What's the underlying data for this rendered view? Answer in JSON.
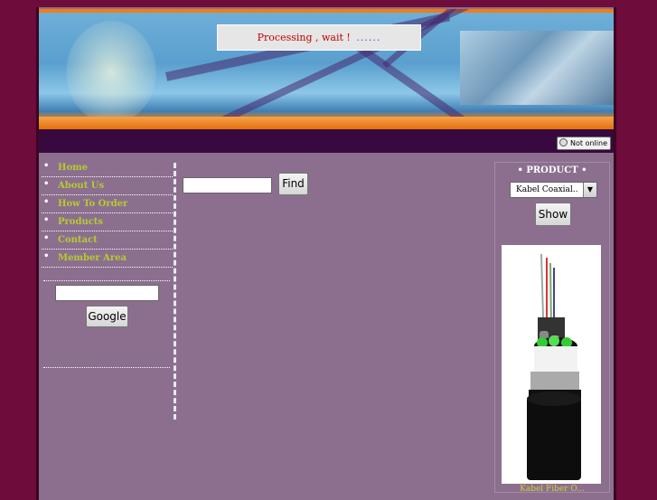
{
  "header": {
    "processing_text": "Processing , wait !",
    "processing_dots": "......"
  },
  "status": {
    "chat_badge": "Not online"
  },
  "nav": {
    "items": [
      {
        "label": "Home"
      },
      {
        "label": "About Us"
      },
      {
        "label": "How To Order"
      },
      {
        "label": "Products"
      },
      {
        "label": "Contact"
      },
      {
        "label": "Member Area"
      }
    ]
  },
  "search": {
    "google_value": "",
    "google_button": "Google",
    "find_value": "",
    "find_button": "Find"
  },
  "product": {
    "title": "• PRODUCT •",
    "selected_option": "Kabel Coaxial..",
    "show_button": "Show",
    "caption": "Kabel Fiber O..."
  },
  "colors": {
    "page_bg": "#6e0c3c",
    "panel_bg": "#8c6f8f",
    "nav_link": "#b5cc2e",
    "status_bar": "#37093f"
  }
}
